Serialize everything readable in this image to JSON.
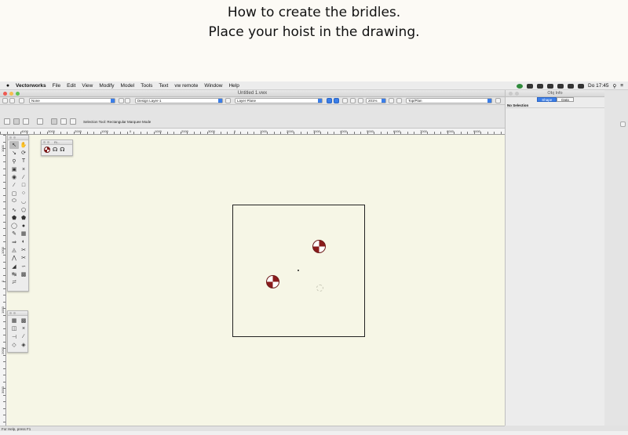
{
  "caption": {
    "line1": "How to create the bridles.",
    "line2": "Place your hoist in the drawing."
  },
  "menubar": {
    "app": "Vectorworks",
    "items": [
      "File",
      "Edit",
      "View",
      "Modify",
      "Model",
      "Tools",
      "Text",
      "vw remote",
      "Window",
      "Help"
    ],
    "clock": "Do 17:45"
  },
  "window": {
    "title": "Untitled 1.vwx"
  },
  "view_bar": {
    "class_dropdown": "None",
    "layer_dropdown": "Design Layer-1",
    "layer_plane_dropdown": "Layer Plane",
    "zoom": "201%",
    "view_dropdown": "Top/Plan"
  },
  "mode_bar": {
    "hint": "Selection Tool: Rectangular Marquee Mode"
  },
  "ruler": {
    "h_labels": [
      "4000",
      "3000",
      "2000",
      "1000",
      "0",
      "1000",
      "2000",
      "3000",
      "4000",
      "5000",
      "6000",
      "7000",
      "0",
      "1000",
      "2000",
      "3000",
      "4000",
      "5000",
      "6000",
      "7000",
      "8000",
      "9000"
    ],
    "v_labels": [
      "1000",
      "2000",
      "3000",
      "4000",
      "1000",
      "0",
      "1000",
      "2000",
      "3000"
    ]
  },
  "palettes": {
    "mini_title": "Ri..."
  },
  "obj_info": {
    "title": "Obj Info",
    "tabs": [
      "Shape",
      "Data"
    ],
    "active_tab": "Shape",
    "selection": "No Selection"
  },
  "status": {
    "text": "For Help, press F1"
  },
  "colors": {
    "hoist_red": "#8a1c1c",
    "canvas_bg": "#f6f6e6",
    "accent_blue": "#3b7ee8"
  }
}
